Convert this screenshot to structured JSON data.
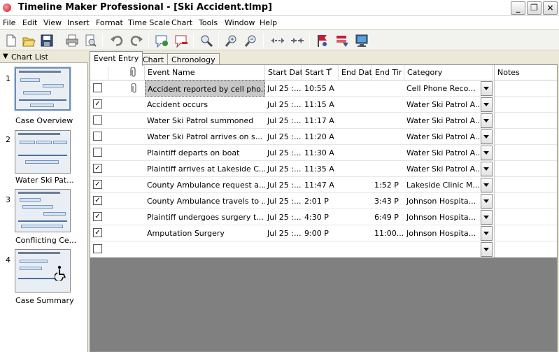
{
  "window": {
    "title": "Timeline Maker Professional - [Ski Accident.tlmp]",
    "min_label": "_",
    "max_label": "❐",
    "close_label": "×"
  },
  "menu": [
    "File",
    "Edit",
    "View",
    "Insert",
    "Format",
    "Time Scale",
    "Chart",
    "Tools",
    "Window",
    "Help"
  ],
  "toolbar": {
    "buttons": [
      "new-icon",
      "open-icon",
      "save-icon",
      "print-icon",
      "print-preview-icon",
      "undo-icon",
      "redo-icon",
      "add-event-icon",
      "delete-event-icon",
      "find-icon",
      "zoom-in-icon",
      "zoom-out-icon",
      "expand-icon",
      "collapse-icon",
      "flag-icon",
      "sort-icon",
      "monitor-icon"
    ]
  },
  "chart_list": {
    "title": "Chart List",
    "items": [
      {
        "number": "1",
        "label": "Case Overview",
        "selected": true
      },
      {
        "number": "2",
        "label": "Water Ski Pat...",
        "selected": false
      },
      {
        "number": "3",
        "label": "Conflicting Ce...",
        "selected": false
      },
      {
        "number": "4",
        "label": "Case Summary",
        "selected": false
      }
    ]
  },
  "tabs": [
    {
      "label": "Event Entry",
      "active": true
    },
    {
      "label": "Chart",
      "active": false
    },
    {
      "label": "Chronology",
      "active": false
    }
  ],
  "grid": {
    "headers": {
      "event_name": "Event Name",
      "start_date": "Start Dat",
      "start_time": "Start T",
      "end_date": "End Dat",
      "end_time": "End Tir",
      "category": "Category",
      "notes": "Notes"
    },
    "rows": [
      {
        "checked": false,
        "attachment": true,
        "selected": true,
        "event_name": "Accident reported by cell pho...",
        "start_date": "Jul 25 :...",
        "start_time": "10:55 A",
        "end_date": "",
        "end_time": "",
        "category": "Cell Phone Reco..."
      },
      {
        "checked": true,
        "attachment": false,
        "selected": false,
        "event_name": "Accident occurs",
        "start_date": "Jul 25 :...",
        "start_time": "11:15 A",
        "end_date": "",
        "end_time": "",
        "category": "Water Ski Patrol A..."
      },
      {
        "checked": false,
        "attachment": false,
        "selected": false,
        "event_name": "Water Ski Patrol summoned",
        "start_date": "Jul 25 :...",
        "start_time": "11:17 A",
        "end_date": "",
        "end_time": "",
        "category": "Water Ski Patrol A..."
      },
      {
        "checked": false,
        "attachment": false,
        "selected": false,
        "event_name": "Water Ski Patrol arrives on s...",
        "start_date": "Jul 25 :...",
        "start_time": "11:20 A",
        "end_date": "",
        "end_time": "",
        "category": "Water Ski Patrol A..."
      },
      {
        "checked": false,
        "attachment": false,
        "selected": false,
        "event_name": "Plaintiff departs on boat",
        "start_date": "Jul 25 :...",
        "start_time": "11:30 A",
        "end_date": "",
        "end_time": "",
        "category": "Water Ski Patrol A..."
      },
      {
        "checked": true,
        "attachment": false,
        "selected": false,
        "event_name": "Plaintiff arrives at Lakeside C...",
        "start_date": "Jul 25 :...",
        "start_time": "11:35 A",
        "end_date": "",
        "end_time": "",
        "category": "Water Ski Patrol A..."
      },
      {
        "checked": true,
        "attachment": false,
        "selected": false,
        "event_name": "County Ambulance request a...",
        "start_date": "Jul 25 :...",
        "start_time": "11:47 A",
        "end_date": "",
        "end_time": "1:52 P",
        "category": "Lakeside Clinic M..."
      },
      {
        "checked": true,
        "attachment": false,
        "selected": false,
        "event_name": "County Ambulance travels to ...",
        "start_date": "Jul 25 :...",
        "start_time": "2:01 P",
        "end_date": "",
        "end_time": "3:43 P",
        "category": "Johnson Hospita..."
      },
      {
        "checked": true,
        "attachment": false,
        "selected": false,
        "event_name": "Plaintiff undergoes surgery t...",
        "start_date": "Jul 25 :...",
        "start_time": "4:30 P",
        "end_date": "",
        "end_time": "6:49 P",
        "category": "Johnson Hospita..."
      },
      {
        "checked": true,
        "attachment": false,
        "selected": false,
        "event_name": "Amputation Surgery",
        "start_date": "Jul 25 :...",
        "start_time": "9:00 P",
        "end_date": "",
        "end_time": "11:00...",
        "category": "Johnson Hospita..."
      },
      {
        "checked": false,
        "attachment": false,
        "selected": false,
        "event_name": "",
        "start_date": "",
        "start_time": "",
        "end_date": "",
        "end_time": "",
        "category": ""
      }
    ]
  }
}
